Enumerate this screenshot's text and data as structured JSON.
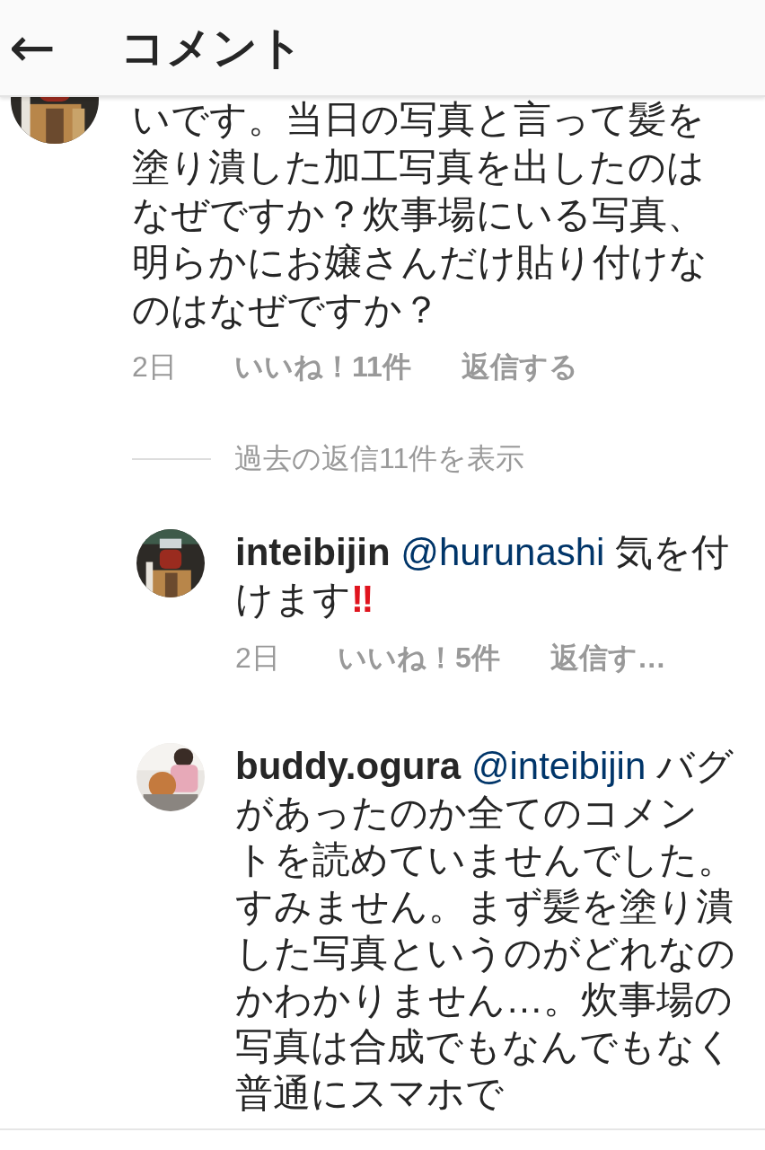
{
  "header": {
    "back": "←",
    "title": "コメント"
  },
  "comment": {
    "text": "いです。当日の写真と言って髪を塗り潰した加工写真を出したのはなぜですか？炊事場にいる写真、明らかにお嬢さんだけ貼り付けなのはなぜですか？",
    "time": "2日",
    "likes": "いいね！11件",
    "reply": "返信する"
  },
  "view_replies": "過去の返信11件を表示",
  "replies": [
    {
      "username": "inteibijin",
      "mention": "@hurunashi",
      "text": " 気を付けます",
      "emoji": "‼",
      "time": "2日",
      "likes": "いいね！5件",
      "reply": "返信す…"
    },
    {
      "username": "buddy.ogura",
      "mention": "@inteibijin",
      "text": " バグがあったのか全てのコメントを読めていませんでした。すみません。まず髪を塗り潰した写真というのがどれなのかわかりません…。炊事場の写真は合成でもなんでもなく普通にスマホで"
    }
  ]
}
